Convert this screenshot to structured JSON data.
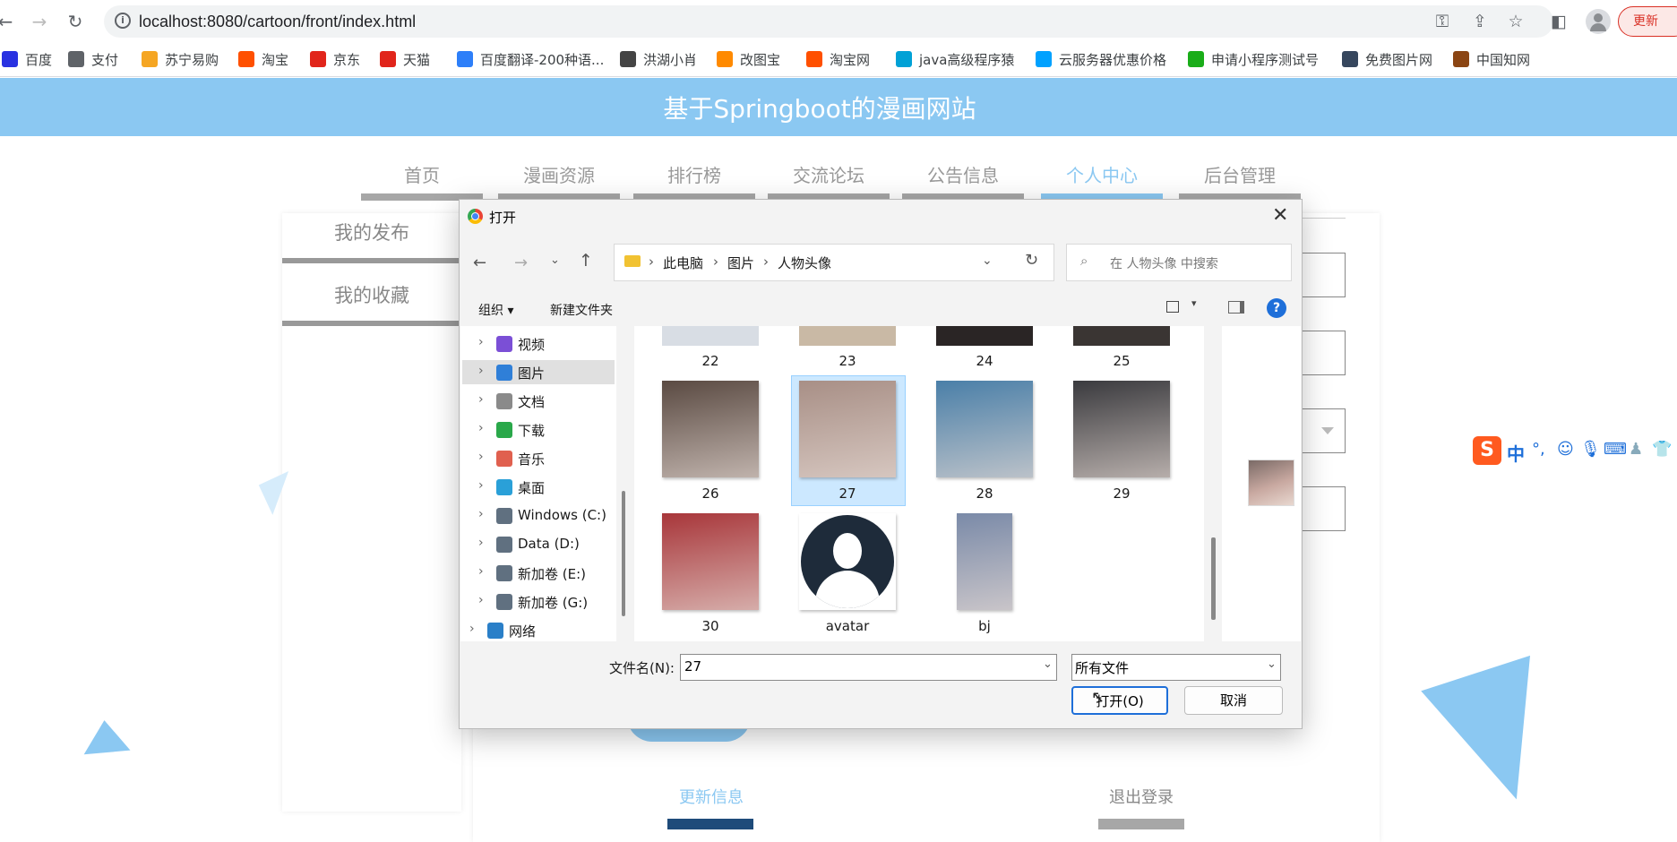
{
  "browser": {
    "url": "localhost:8080/cartoon/front/index.html",
    "update_label": "更新"
  },
  "bookmarks": [
    {
      "label": "百度",
      "icon": "baidu-icon",
      "color": "#2932e1"
    },
    {
      "label": "支付",
      "icon": "globe-icon",
      "color": "#5f6368"
    },
    {
      "label": "苏宁易购",
      "icon": "suning-icon",
      "color": "#f5a623"
    },
    {
      "label": "淘宝",
      "icon": "taobao-icon",
      "color": "#ff5000"
    },
    {
      "label": "京东",
      "icon": "jd-icon",
      "color": "#e1251b"
    },
    {
      "label": "天猫",
      "icon": "tmall-icon",
      "color": "#e1251b"
    },
    {
      "label": "百度翻译-200种语...",
      "icon": "translate-icon",
      "color": "#2d7ff9"
    },
    {
      "label": "洪湖小肖",
      "icon": "bookmark-icon",
      "color": "#444"
    },
    {
      "label": "改图宝",
      "icon": "gaitubao-icon",
      "color": "#ff8a00"
    },
    {
      "label": "淘宝网",
      "icon": "taobao-icon",
      "color": "#ff5000"
    },
    {
      "label": "java高级程序猿",
      "icon": "bilibili-icon",
      "color": "#00a1d6"
    },
    {
      "label": "云服务器优惠价格",
      "icon": "cloud-icon",
      "color": "#00a1ff"
    },
    {
      "label": "申请小程序测试号",
      "icon": "wechat-icon",
      "color": "#1aad19"
    },
    {
      "label": "免费图片网",
      "icon": "tumblr-icon",
      "color": "#36465d"
    },
    {
      "label": "中国知网",
      "icon": "cnki-icon",
      "color": "#8b4513"
    }
  ],
  "site": {
    "title": "基于Springboot的漫画网站",
    "nav": [
      "首页",
      "漫画资源",
      "排行榜",
      "交流论坛",
      "公告信息",
      "个人中心",
      "后台管理"
    ],
    "active_nav": "个人中心",
    "side_menu": [
      "我的发布",
      "我的收藏"
    ],
    "bottom_links": [
      "更新信息",
      "退出登录"
    ],
    "accent": "#8bc8f2"
  },
  "dialog": {
    "title": "打开",
    "breadcrumb": [
      "此电脑",
      "图片",
      "人物头像"
    ],
    "search_placeholder": "在 人物头像 中搜索",
    "toolbar": {
      "organize": "组织 ▾",
      "new_folder": "新建文件夹"
    },
    "tree": [
      {
        "label": "视频",
        "icon": "video-folder-icon",
        "color": "#7b4fd6"
      },
      {
        "label": "图片",
        "icon": "pictures-folder-icon",
        "color": "#2f7fd8",
        "selected": true
      },
      {
        "label": "文档",
        "icon": "documents-folder-icon",
        "color": "#8a8a8a"
      },
      {
        "label": "下载",
        "icon": "downloads-folder-icon",
        "color": "#2aa84a"
      },
      {
        "label": "音乐",
        "icon": "music-folder-icon",
        "color": "#e0604f"
      },
      {
        "label": "桌面",
        "icon": "desktop-folder-icon",
        "color": "#2aa0d8"
      },
      {
        "label": "Windows (C:)",
        "icon": "drive-icon",
        "color": "#607080"
      },
      {
        "label": "Data (D:)",
        "icon": "drive-icon",
        "color": "#607080"
      },
      {
        "label": "新加卷 (E:)",
        "icon": "drive-icon",
        "color": "#607080"
      },
      {
        "label": "新加卷 (G:)",
        "icon": "drive-icon",
        "color": "#607080"
      },
      {
        "label": "网络",
        "icon": "network-icon",
        "color": "#2a7fc8"
      }
    ],
    "files": [
      {
        "name": "22",
        "color": "#d8dde4"
      },
      {
        "name": "23",
        "color": "#c9b9a5"
      },
      {
        "name": "24",
        "color": "#2a2525"
      },
      {
        "name": "25",
        "color": "#3a3533"
      },
      {
        "name": "26",
        "color": "#5a4a42"
      },
      {
        "name": "27",
        "color": "#a88f86",
        "selected": true
      },
      {
        "name": "28",
        "color": "#4a7fa8"
      },
      {
        "name": "29",
        "color": "#3a3a3e"
      },
      {
        "name": "30",
        "color": "#a8363a"
      },
      {
        "name": "avatar",
        "color": "#1e2b3a"
      },
      {
        "name": "bj",
        "color": "#7a8aa8"
      }
    ],
    "filename_label": "文件名(N):",
    "filename_value": "27",
    "filetype_value": "所有文件",
    "open_label": "打开(O)",
    "cancel_label": "取消"
  },
  "ime": {
    "label": "中"
  }
}
